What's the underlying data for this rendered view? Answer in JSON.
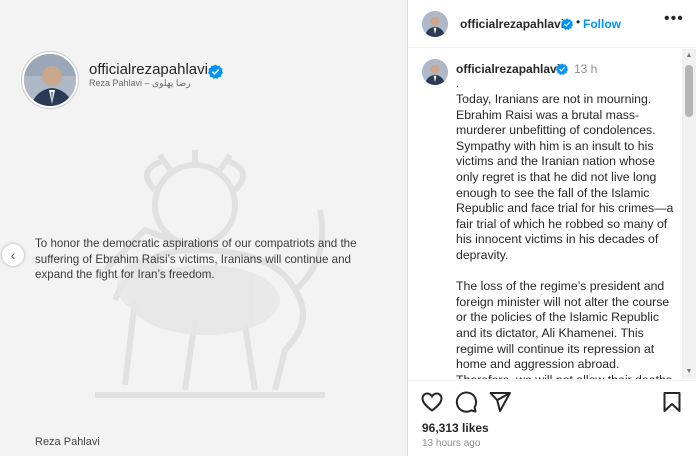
{
  "media": {
    "author_handle": "officialrezapahlavi",
    "author_subtitle": "Reza Pahlavi – رضا پهلوی",
    "quote": "To honor the democratic aspirations of our compatriots and the suffering of Ebrahim Raisi’s victims, Iranians will continue and expand the fight for Iran’s freedom.",
    "footer_name": "Reza Pahlavi",
    "prev_glyph": "‹",
    "prev_icon": "chevron-left-icon"
  },
  "header": {
    "username": "officialrezapahlavi",
    "separator": "•",
    "follow_label": "Follow",
    "more_glyph": "•••"
  },
  "caption": {
    "username": "officialrezapahlavi",
    "time": "13 h",
    "lead": ".",
    "paragraphs": [
      "Today, Iranians are not in mourning. Ebrahim Raisi was a brutal mass-murderer unbefitting of condolences. Sympathy with him is an insult to his victims and the Iranian nation whose only regret is that he did not live long enough to see the fall of the Islamic Republic and face trial for his crimes—a fair trial of which he robbed so many of his innocent victims in his decades of depravity.",
      "The loss of the regime’s president and foreign minister will not alter the course or the policies of the Islamic Republic and its dictator, Ali Khamenei. This regime will continue its repression at home and aggression abroad. Therefore, we will not allow their deaths"
    ]
  },
  "scrollbar": {
    "up_glyph": "▲",
    "down_glyph": "▼"
  },
  "footer": {
    "likes": "96,313 likes",
    "time_ago": "13 hours ago"
  },
  "icons": [
    "heart-icon",
    "comment-icon",
    "share-icon",
    "bookmark-icon",
    "verified-badge-icon",
    "more-options-icon"
  ],
  "colors": {
    "accent": "#0095f6",
    "verified": "#0095f6",
    "text": "#262626",
    "muted": "#8e8e8e",
    "image_bg": "#f3f3f3"
  }
}
